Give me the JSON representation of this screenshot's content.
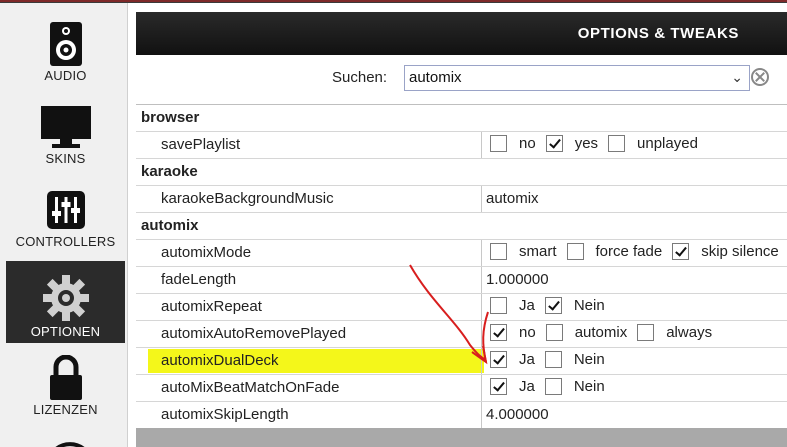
{
  "nav": {
    "items": [
      {
        "label": "AUDIO",
        "icon": "speaker-icon"
      },
      {
        "label": "SKINS",
        "icon": "monitor-icon"
      },
      {
        "label": "CONTROLLERS",
        "icon": "sliders-icon"
      },
      {
        "label": "OPTIONEN",
        "icon": "gear-icon",
        "active": true
      },
      {
        "label": "LIZENZEN",
        "icon": "lock-icon"
      }
    ]
  },
  "header": {
    "title": "OPTIONS & TWEAKS"
  },
  "search": {
    "label": "Suchen:",
    "value": "automix"
  },
  "sections": [
    {
      "title": "browser",
      "rows": [
        {
          "name": "savePlaylist",
          "options": [
            {
              "label": "no",
              "checked": false
            },
            {
              "label": "yes",
              "checked": true
            },
            {
              "label": "unplayed",
              "checked": false
            }
          ]
        }
      ]
    },
    {
      "title": "karaoke",
      "rows": [
        {
          "name": "karaokeBackgroundMusic",
          "value": "automix"
        }
      ]
    },
    {
      "title": "automix",
      "rows": [
        {
          "name": "automixMode",
          "options": [
            {
              "label": "smart",
              "checked": false
            },
            {
              "label": "force fade",
              "checked": false
            },
            {
              "label": "skip silence",
              "checked": true
            }
          ]
        },
        {
          "name": "fadeLength",
          "value": "1.000000"
        },
        {
          "name": "automixRepeat",
          "options": [
            {
              "label": "Ja",
              "checked": false
            },
            {
              "label": "Nein",
              "checked": true
            }
          ]
        },
        {
          "name": "automixAutoRemovePlayed",
          "options": [
            {
              "label": "no",
              "checked": true
            },
            {
              "label": "automix",
              "checked": false
            },
            {
              "label": "always",
              "checked": false
            }
          ]
        },
        {
          "name": "automixDualDeck",
          "highlighted": true,
          "options": [
            {
              "label": "Ja",
              "checked": true
            },
            {
              "label": "Nein",
              "checked": false
            }
          ]
        },
        {
          "name": "autoMixBeatMatchOnFade",
          "options": [
            {
              "label": "Ja",
              "checked": true
            },
            {
              "label": "Nein",
              "checked": false
            }
          ]
        },
        {
          "name": "automixSkipLength",
          "value": "4.000000"
        }
      ]
    }
  ],
  "colors": {
    "highlight": "#f4f71a",
    "annotation": "#d81e1e",
    "header_bg": "#1a1a1a",
    "nav_active": "#2b2b2b"
  }
}
